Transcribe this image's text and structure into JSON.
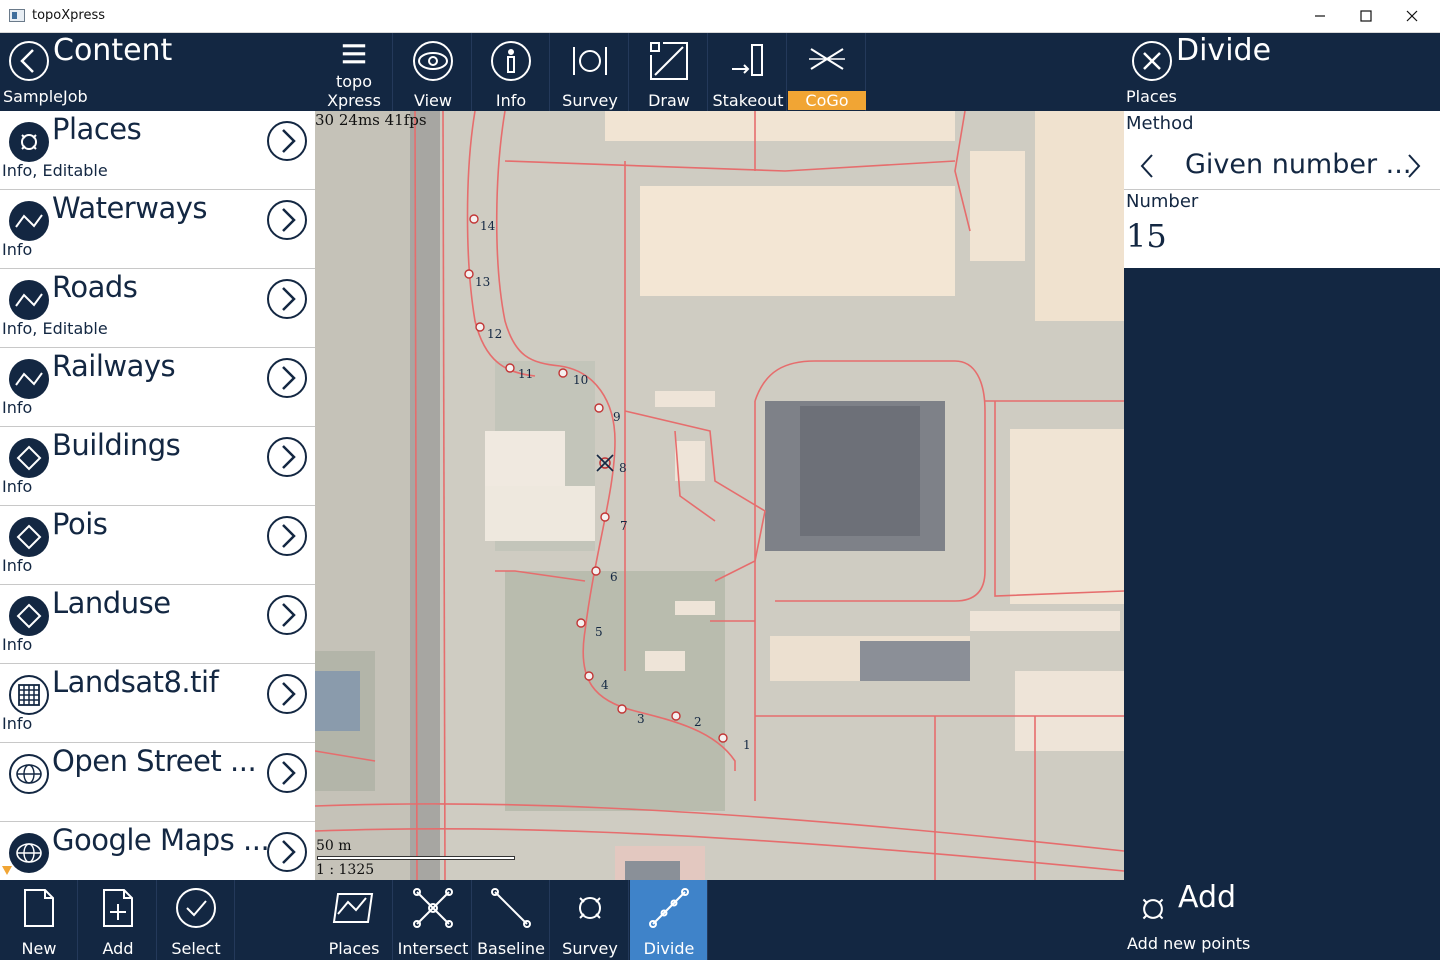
{
  "window": {
    "title": "topoXpress"
  },
  "left_panel": {
    "title": "Content",
    "subtitle": "SampleJob"
  },
  "layers": [
    {
      "name": "Places",
      "sub": "Info, Editable",
      "icon": "places-icon"
    },
    {
      "name": "Waterways",
      "sub": "Info",
      "icon": "line-layer-icon"
    },
    {
      "name": "Roads",
      "sub": "Info, Editable",
      "icon": "line-layer-icon"
    },
    {
      "name": "Railways",
      "sub": "Info",
      "icon": "line-layer-icon"
    },
    {
      "name": "Buildings",
      "sub": "Info",
      "icon": "polygon-layer-icon"
    },
    {
      "name": "Pois",
      "sub": "Info",
      "icon": "polygon-layer-icon"
    },
    {
      "name": "Landuse",
      "sub": "Info",
      "icon": "polygon-layer-icon"
    },
    {
      "name": "Landsat8.tif",
      "sub": "Info",
      "icon": "raster-grid-icon"
    },
    {
      "name": "Open Street ...",
      "sub": "",
      "icon": "globe-icon"
    },
    {
      "name": "Google Maps ...",
      "sub": "",
      "icon": "globe-icon"
    }
  ],
  "top_toolbar": {
    "menu": {
      "line1": "topo",
      "line2": "Xpress"
    },
    "view": "View",
    "info": "Info",
    "survey": "Survey",
    "draw": "Draw",
    "stakeout": "Stakeout",
    "cogo": "CoGo"
  },
  "map": {
    "fps": "30 24ms 41fps",
    "scale_label": "50 m",
    "scale_ratio": "1 : 1325",
    "points": [
      "1",
      "2",
      "3",
      "4",
      "5",
      "6",
      "7",
      "8",
      "9",
      "10",
      "11",
      "12",
      "13",
      "14"
    ]
  },
  "right_panel": {
    "title": "Divide",
    "subtitle": "Places",
    "method_label": "Method",
    "method_value": "Given number ...",
    "number_label": "Number",
    "number_value": "15"
  },
  "bottom_left": {
    "new": "New",
    "add": "Add",
    "select": "Select"
  },
  "bottom_mid": {
    "places": "Places",
    "intersect": "Intersect",
    "baseline": "Baseline",
    "survey": "Survey",
    "divide": "Divide"
  },
  "bottom_right": {
    "title": "Add",
    "subtitle": "Add new points"
  },
  "colors": {
    "navy": "#132742",
    "accent_orange": "#f1a534",
    "active_blue": "#3f83c9",
    "map_line": "#e46a6a"
  }
}
